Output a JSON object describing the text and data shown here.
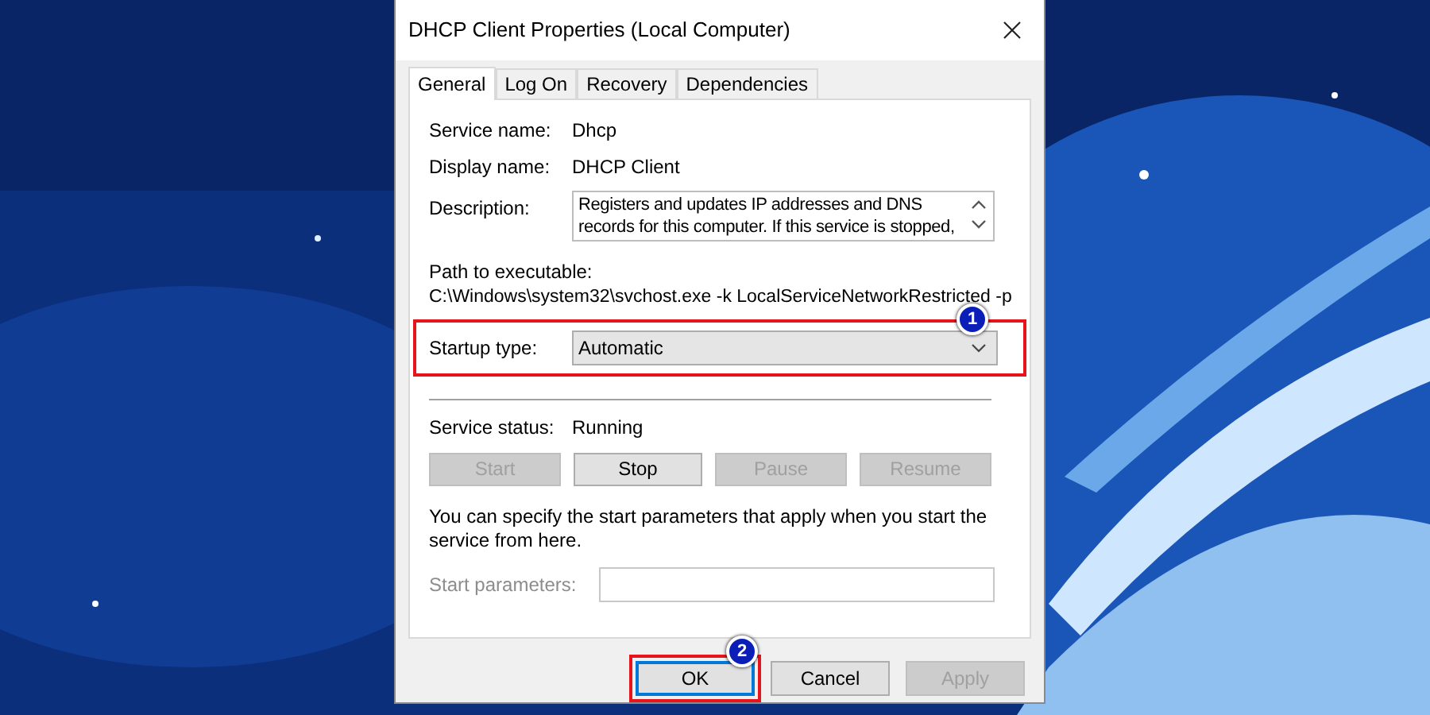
{
  "window": {
    "title": "DHCP Client Properties (Local Computer)"
  },
  "tabs": [
    {
      "label": "General",
      "selected": true
    },
    {
      "label": "Log On",
      "selected": false
    },
    {
      "label": "Recovery",
      "selected": false
    },
    {
      "label": "Dependencies",
      "selected": false
    }
  ],
  "service_name": {
    "label": "Service name:",
    "value": "Dhcp"
  },
  "display_name": {
    "label": "Display name:",
    "value": "DHCP Client"
  },
  "description": {
    "label": "Description:",
    "value": "Registers and updates IP addresses and DNS records for this computer. If this service is stopped,"
  },
  "path": {
    "label": "Path to executable:",
    "value": "C:\\Windows\\system32\\svchost.exe -k LocalServiceNetworkRestricted -p"
  },
  "startup_type": {
    "label": "Startup type:",
    "value": "Automatic",
    "highlighted": true,
    "badge": "1"
  },
  "service_status": {
    "label": "Service status:",
    "value": "Running"
  },
  "service_buttons": [
    {
      "label": "Start",
      "disabled": true
    },
    {
      "label": "Stop",
      "disabled": false
    },
    {
      "label": "Pause",
      "disabled": true
    },
    {
      "label": "Resume",
      "disabled": true
    }
  ],
  "hint": "You can specify the start parameters that apply when you start the service from here.",
  "start_parameters": {
    "label": "Start parameters:",
    "disabled": true
  },
  "dialog_buttons": [
    {
      "label": "OK",
      "disabled": false,
      "default": true,
      "highlighted": true,
      "badge": "2"
    },
    {
      "label": "Cancel",
      "disabled": false,
      "default": false,
      "highlighted": false
    },
    {
      "label": "Apply",
      "disabled": true,
      "default": false,
      "highlighted": false
    }
  ]
}
